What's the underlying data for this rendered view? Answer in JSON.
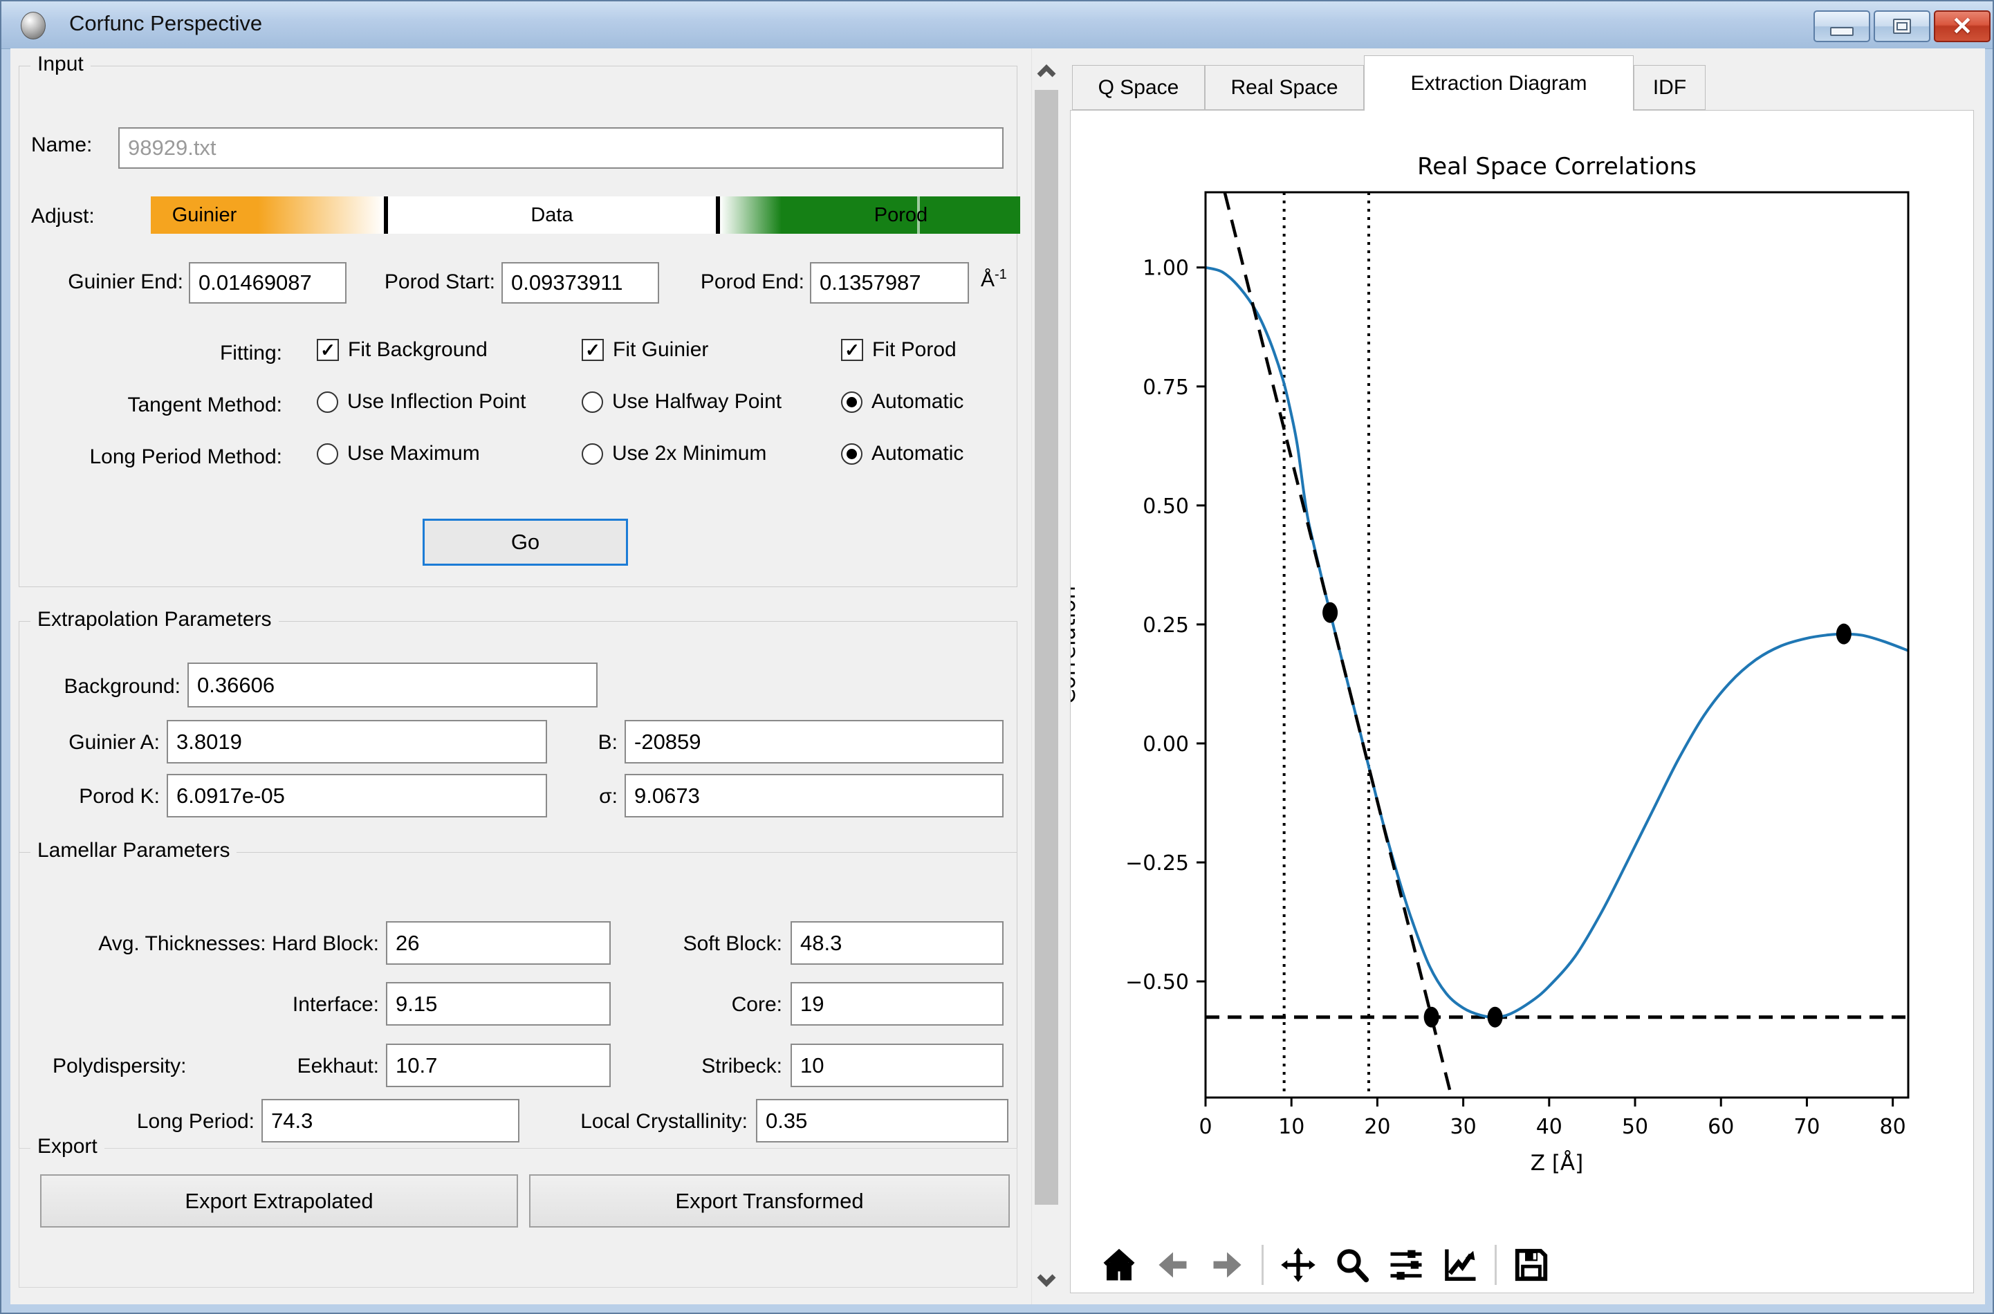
{
  "window": {
    "title": "Corfunc Perspective"
  },
  "window_controls": {
    "minimize": "minimize",
    "maximize": "maximize",
    "close": "close"
  },
  "left_panel": {
    "input": {
      "title": "Input",
      "name_label": "Name:",
      "name_value": "98929.txt",
      "adjust_label": "Adjust:",
      "slider": {
        "guinier": "Guinier",
        "data": "Data",
        "porod": "Porod",
        "orange": "#F5A41F",
        "green": "#158015"
      },
      "guinier_end": {
        "label": "Guinier End:",
        "value": "0.01469087"
      },
      "porod_start": {
        "label": "Porod Start:",
        "value": "0.09373911"
      },
      "porod_end": {
        "label": "Porod End:",
        "value": "0.1357987"
      },
      "unit": {
        "base": "Å",
        "exp": "-1"
      },
      "fitting": {
        "label": "Fitting:",
        "options": [
          {
            "label": "Fit Background",
            "checked": true
          },
          {
            "label": "Fit Guinier",
            "checked": true
          },
          {
            "label": "Fit Porod",
            "checked": true
          }
        ]
      },
      "tangent": {
        "label": "Tangent Method:",
        "options": [
          {
            "label": "Use Inflection Point",
            "selected": false
          },
          {
            "label": "Use Halfway Point",
            "selected": false
          },
          {
            "label": "Automatic",
            "selected": true
          }
        ]
      },
      "long_period": {
        "label": "Long Period Method:",
        "options": [
          {
            "label": "Use Maximum",
            "selected": false
          },
          {
            "label": "Use 2x Minimum",
            "selected": false
          },
          {
            "label": "Automatic",
            "selected": true
          }
        ]
      },
      "go_label": "Go"
    },
    "extrapolation": {
      "title": "Extrapolation Parameters",
      "background": {
        "label": "Background:",
        "value": "0.36606"
      },
      "guinier_a": {
        "label": "Guinier A:",
        "value": "3.8019"
      },
      "b": {
        "label": "B:",
        "value": "-20859"
      },
      "porod_k": {
        "label": "Porod K:",
        "value": "6.0917e-05"
      },
      "sigma": {
        "label": "σ:",
        "value": "9.0673"
      }
    },
    "lamellar": {
      "title": "Lamellar Parameters",
      "hard_block": {
        "label": "Avg. Thicknesses: Hard Block:",
        "value": "26"
      },
      "soft_block": {
        "label": "Soft Block:",
        "value": "48.3"
      },
      "interface": {
        "label": "Interface:",
        "value": "9.15"
      },
      "core": {
        "label": "Core:",
        "value": "19"
      },
      "polydispersity_label": "Polydispersity:",
      "eekhaut": {
        "label": "Eekhaut:",
        "value": "10.7"
      },
      "stribeck": {
        "label": "Stribeck:",
        "value": "10"
      },
      "long_period": {
        "label": "Long Period:",
        "value": "74.3"
      },
      "local_crystallinity": {
        "label": "Local Crystallinity:",
        "value": "0.35"
      }
    },
    "export": {
      "title": "Export",
      "extrapolated_label": "Export Extrapolated",
      "transformed_label": "Export Transformed"
    }
  },
  "right_panel": {
    "tabs": [
      {
        "label": "Q Space",
        "active": false
      },
      {
        "label": "Real Space",
        "active": false
      },
      {
        "label": "Extraction Diagram",
        "active": true
      },
      {
        "label": "IDF",
        "active": false
      }
    ],
    "toolbar_icons": [
      "home",
      "back",
      "forward",
      "pan",
      "zoom",
      "configure-subplots",
      "edit-plot",
      "save"
    ]
  },
  "chart_data": {
    "type": "line",
    "title": "Real Space Correlations",
    "xlabel": "Z [Å]",
    "ylabel": "Correlation",
    "xlim": [
      0,
      81.8
    ],
    "ylim": [
      -0.744,
      1.158
    ],
    "xticks": [
      0,
      10,
      20,
      30,
      40,
      50,
      60,
      70,
      80
    ],
    "yticks": [
      1.0,
      0.75,
      0.5,
      0.25,
      0.0,
      -0.25,
      -0.5
    ],
    "ytick_labels": [
      "1.00",
      "0.75",
      "0.50",
      "0.25",
      "0.00",
      "−0.25",
      "−0.50"
    ],
    "grid": false,
    "series": [
      {
        "name": "correlation-function",
        "color": "#1f77b4",
        "style": "solid",
        "width": 4,
        "points": [
          [
            0,
            1.0
          ],
          [
            2,
            0.99
          ],
          [
            4,
            0.957
          ],
          [
            6,
            0.905
          ],
          [
            7.5,
            0.845
          ],
          [
            9,
            0.765
          ],
          [
            10,
            0.69
          ],
          [
            10.7,
            0.625
          ],
          [
            11.5,
            0.52
          ],
          [
            12,
            0.465
          ],
          [
            13,
            0.387
          ],
          [
            14.5,
            0.275
          ],
          [
            16,
            0.167
          ],
          [
            18,
            0.023
          ],
          [
            20,
            -0.121
          ],
          [
            21,
            -0.19
          ],
          [
            22.5,
            -0.285
          ],
          [
            24,
            -0.37
          ],
          [
            26,
            -0.465
          ],
          [
            28,
            -0.525
          ],
          [
            30,
            -0.556
          ],
          [
            32,
            -0.571
          ],
          [
            33.7,
            -0.575
          ],
          [
            35.5,
            -0.568
          ],
          [
            38,
            -0.541
          ],
          [
            40,
            -0.51
          ],
          [
            43,
            -0.448
          ],
          [
            46,
            -0.358
          ],
          [
            49,
            -0.252
          ],
          [
            52,
            -0.143
          ],
          [
            55,
            -0.035
          ],
          [
            58,
            0.058
          ],
          [
            61,
            0.127
          ],
          [
            64,
            0.175
          ],
          [
            67,
            0.205
          ],
          [
            70,
            0.221
          ],
          [
            72.5,
            0.228
          ],
          [
            74.3,
            0.23
          ],
          [
            76.5,
            0.227
          ],
          [
            79,
            0.214
          ],
          [
            81.8,
            0.195
          ]
        ]
      },
      {
        "name": "tangent-line",
        "color": "#000000",
        "style": "dashed",
        "width": 4.5,
        "points": [
          [
            2.23,
            1.158
          ],
          [
            28.65,
            -0.744
          ]
        ]
      }
    ],
    "vlines": [
      {
        "x": 9.15,
        "style": "dotted",
        "width": 4
      },
      {
        "x": 19.0,
        "style": "dotted",
        "width": 4
      }
    ],
    "hlines": [
      {
        "y": -0.575,
        "style": "dashed",
        "width": 5
      }
    ],
    "markers": {
      "color": "#000000",
      "points": [
        [
          14.5,
          0.275
        ],
        [
          26.3,
          -0.575
        ],
        [
          33.7,
          -0.575
        ],
        [
          74.3,
          0.23
        ]
      ]
    }
  }
}
